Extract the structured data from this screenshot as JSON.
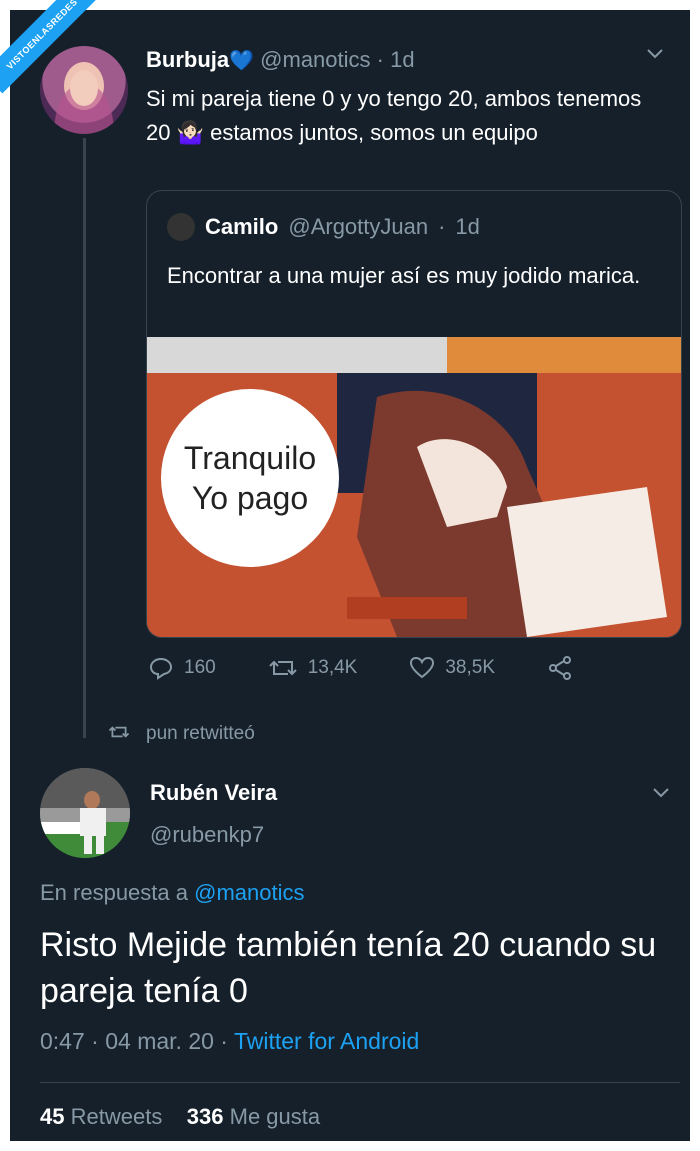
{
  "watermark": "VISTOENLASREDES",
  "tweet1": {
    "name": "Burbuja",
    "badge_icon": "blue-heart",
    "handle": "@manotics",
    "time": "1d",
    "text": "Si mi pareja tiene 0 y yo tengo 20, ambos tenemos 20 🤷🏻‍♀️ estamos juntos, somos un equipo",
    "quoted": {
      "name": "Camilo",
      "handle": "@ArgottyJuan",
      "time": "1d",
      "text": "Encontrar a una mujer así es muy jodido marica.",
      "image_text_line1": "Tranquilo",
      "image_text_line2": "Yo pago"
    },
    "actions": {
      "replies": "160",
      "retweets": "13,4K",
      "likes": "38,5K"
    }
  },
  "retweet_note": "pun retwitteó",
  "tweet2": {
    "name": "Rubén Veira",
    "handle": "@rubenkp7",
    "reply_prefix": "En respuesta a",
    "reply_handle": "@manotics",
    "text": "Risto Mejide también tenía 20 cuando su pareja tenía 0",
    "time": "0:47",
    "date": "04 mar. 20",
    "source": "Twitter for Android",
    "retweets_count": "45",
    "retweets_label": "Retweets",
    "likes_count": "336",
    "likes_label": "Me gusta"
  },
  "colors": {
    "background": "#15202b",
    "accent": "#1da1f2",
    "muted": "#8899a6",
    "border": "#38444d"
  }
}
